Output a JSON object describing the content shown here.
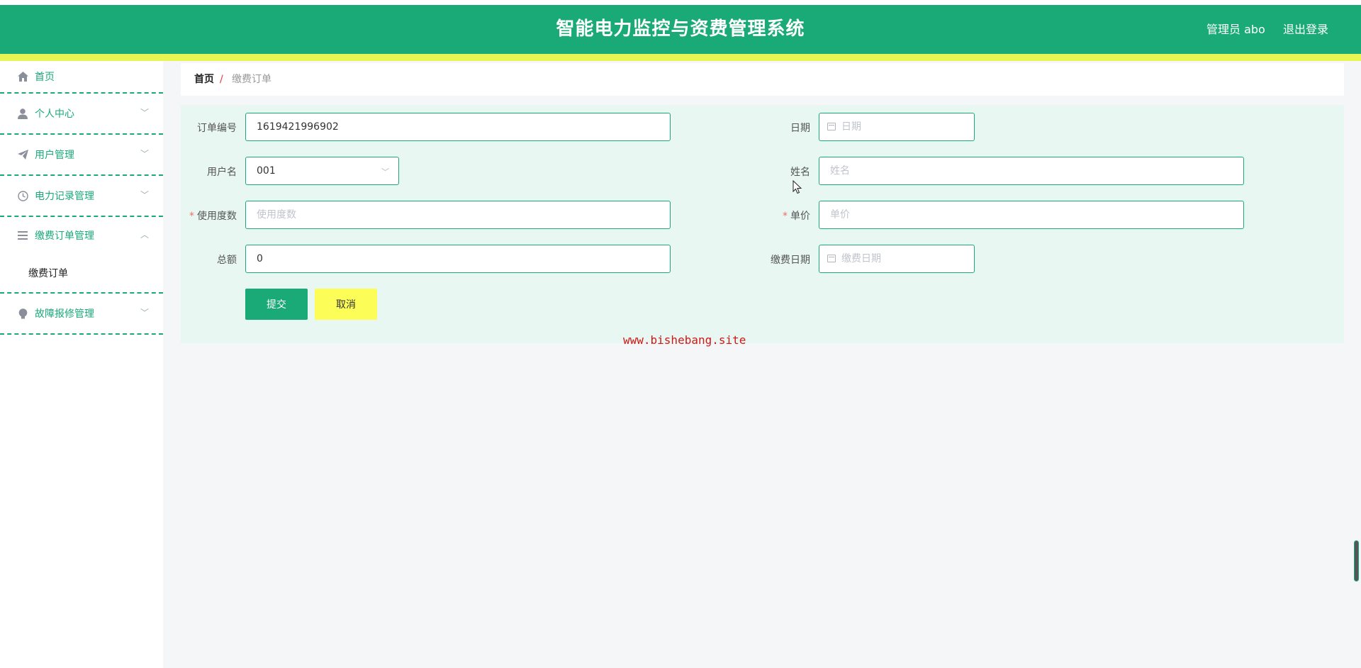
{
  "header": {
    "title": "智能电力监控与资费管理系统",
    "user": "管理员 abo",
    "logout": "退出登录"
  },
  "sidebar": {
    "items": [
      {
        "label": "首页",
        "icon": "home-icon"
      },
      {
        "label": "个人中心",
        "icon": "user-icon"
      },
      {
        "label": "用户管理",
        "icon": "send-icon"
      },
      {
        "label": "电力记录管理",
        "icon": "clock-icon"
      },
      {
        "label": "缴费订单管理",
        "icon": "menu-icon",
        "expanded": true
      },
      {
        "label": "故障报修管理",
        "icon": "bulb-icon"
      }
    ],
    "subitems": [
      {
        "label": "缴费订单"
      }
    ]
  },
  "breadcrumb": {
    "home": "首页",
    "separator": "/",
    "current": "缴费订单"
  },
  "form": {
    "order_no": {
      "label": "订单编号",
      "value": "1619421996902"
    },
    "date": {
      "label": "日期",
      "placeholder": "日期"
    },
    "username": {
      "label": "用户名",
      "value": "001"
    },
    "name": {
      "label": "姓名",
      "placeholder": "姓名"
    },
    "usage": {
      "label": "使用度数",
      "placeholder": "使用度数",
      "required_mark": "*"
    },
    "price": {
      "label": "单价",
      "placeholder": "单价",
      "required_mark": "*"
    },
    "total": {
      "label": "总额",
      "value": "0"
    },
    "pay_date": {
      "label": "缴费日期",
      "placeholder": "缴费日期"
    },
    "submit": "提交",
    "cancel": "取消"
  },
  "watermark": "www.bishebang.site",
  "colors": {
    "primary": "#1aaa78",
    "accent_yellow": "#e8f552",
    "cancel_button": "#fdfd57",
    "panel_bg": "#e8f7f1"
  }
}
